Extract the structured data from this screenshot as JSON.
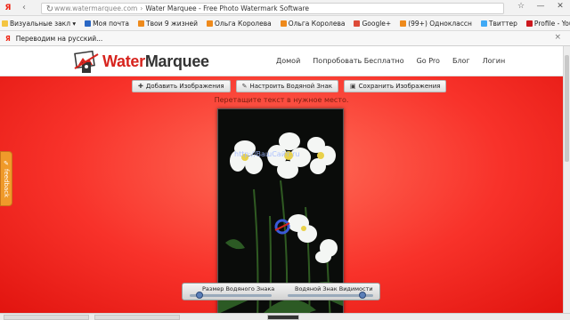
{
  "browser": {
    "url": "www.watermarquee.com",
    "separator": "›",
    "title": "Water Marquee - Free Photo Watermark Software",
    "ya_label": "Я"
  },
  "bookmarks": [
    {
      "label": "Визуальные закл ▾",
      "color": "#f4c542"
    },
    {
      "label": "Моя почта",
      "color": "#2a67c4"
    },
    {
      "label": "Твои 9 жизней",
      "color": "#ee8a1c"
    },
    {
      "label": "Ольга Королева",
      "color": "#ee8a1c"
    },
    {
      "label": "Ольга Королева",
      "color": "#ee8a1c"
    },
    {
      "label": "Google+",
      "color": "#dd4b39"
    },
    {
      "label": "(99+) Одноклассн",
      "color": "#ee8a1c"
    },
    {
      "label": "Твиттер",
      "color": "#3fa9f5"
    },
    {
      "label": "Profile - YouTube",
      "color": "#cc181e"
    }
  ],
  "translate_bar": {
    "ya_label": "Я",
    "text": "Переводим на русский...",
    "close": "×"
  },
  "site": {
    "logo_water": "Water",
    "logo_marquee": "Marquee",
    "nav": [
      "Домой",
      "Попробовать Бесплатно",
      "Go Pro",
      "Блог",
      "Логин"
    ]
  },
  "toolbar": {
    "add_images": "Добавить Изображения",
    "set_watermark": "Настроить Водяной Знак",
    "save_images": "Сохранить Изображения"
  },
  "hint": "Перетащите текст в нужное место.",
  "watermark_text": "http://ВашСайт.ru",
  "feedback_label": "feedback",
  "sliders": {
    "size_label": "Размер Водяного Знака",
    "size_value": 0.12,
    "visibility_label": "Водяной Знак Видимости",
    "visibility_value": 0.88
  },
  "colors": {
    "accent": "#d7241e",
    "page_red": "#f8322a",
    "feedback": "#f09a2a"
  }
}
